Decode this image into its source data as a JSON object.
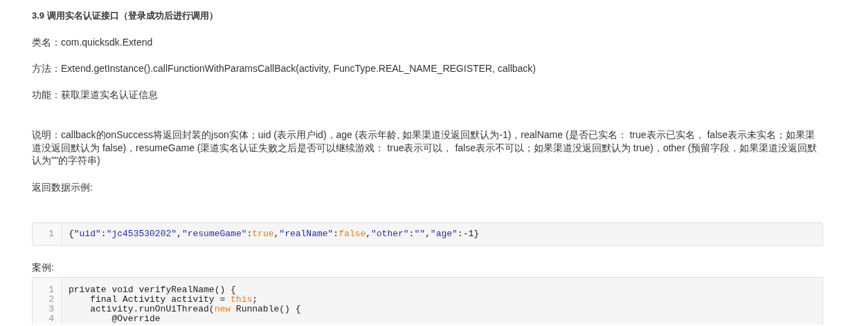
{
  "heading": "3.9 调用实名认证接口（登录成功后进行调用）",
  "paragraphs": [
    "类名：com.quicksdk.Extend",
    "方法：Extend.getInstance().callFunctionWithParamsCallBack(activity, FuncType.REAL_NAME_REGISTER, callback)",
    "功能：获取渠道实名认证信息"
  ],
  "description": "说明：callback的onSuccess将返回封装的json实体；uid (表示用户id)，age (表示年龄, 如果渠道没返回默认为-1)，realName (是否已实名： true表示已实名， false表示未实名；如果渠道没返回默认为 false)，resumeGame (渠道实名认证失败之后是否可以继续游戏： true表示可以， false表示不可以；如果渠道没返回默认为 true)，other (预留字段，如果渠道没返回默认为\"\"的字符串)",
  "example_label": "返回数据示例:",
  "example_code": [
    {
      "number": "1",
      "tokens": [
        {
          "kind": "plain",
          "text": "{"
        },
        {
          "kind": "string",
          "text": "\"uid\""
        },
        {
          "kind": "plain",
          "text": ":"
        },
        {
          "kind": "string",
          "text": "\"jc453530202\""
        },
        {
          "kind": "plain",
          "text": ","
        },
        {
          "kind": "string",
          "text": "\"resumeGame\""
        },
        {
          "kind": "plain",
          "text": ":"
        },
        {
          "kind": "keyword",
          "text": "true"
        },
        {
          "kind": "plain",
          "text": ","
        },
        {
          "kind": "string",
          "text": "\"realName\""
        },
        {
          "kind": "plain",
          "text": ":"
        },
        {
          "kind": "keyword",
          "text": "false"
        },
        {
          "kind": "plain",
          "text": ","
        },
        {
          "kind": "string",
          "text": "\"other\""
        },
        {
          "kind": "plain",
          "text": ":"
        },
        {
          "kind": "string",
          "text": "\"\""
        },
        {
          "kind": "plain",
          "text": ","
        },
        {
          "kind": "string",
          "text": "\"age\""
        },
        {
          "kind": "plain",
          "text": ":-1}"
        }
      ]
    }
  ],
  "case_label": "案例:",
  "case_code": [
    {
      "number": "1",
      "tokens": [
        {
          "kind": "plain",
          "text": "private void verifyRealName() {"
        }
      ]
    },
    {
      "number": "2",
      "tokens": [
        {
          "kind": "plain",
          "text": "    final Activity activity = "
        },
        {
          "kind": "keyword",
          "text": "this"
        },
        {
          "kind": "plain",
          "text": ";"
        }
      ]
    },
    {
      "number": "3",
      "tokens": [
        {
          "kind": "plain",
          "text": "    activity.runOnUiThread("
        },
        {
          "kind": "keyword",
          "text": "new"
        },
        {
          "kind": "plain",
          "text": " Runnable() {"
        }
      ]
    },
    {
      "number": "4",
      "tokens": [
        {
          "kind": "plain",
          "text": "        @Override"
        }
      ]
    }
  ]
}
